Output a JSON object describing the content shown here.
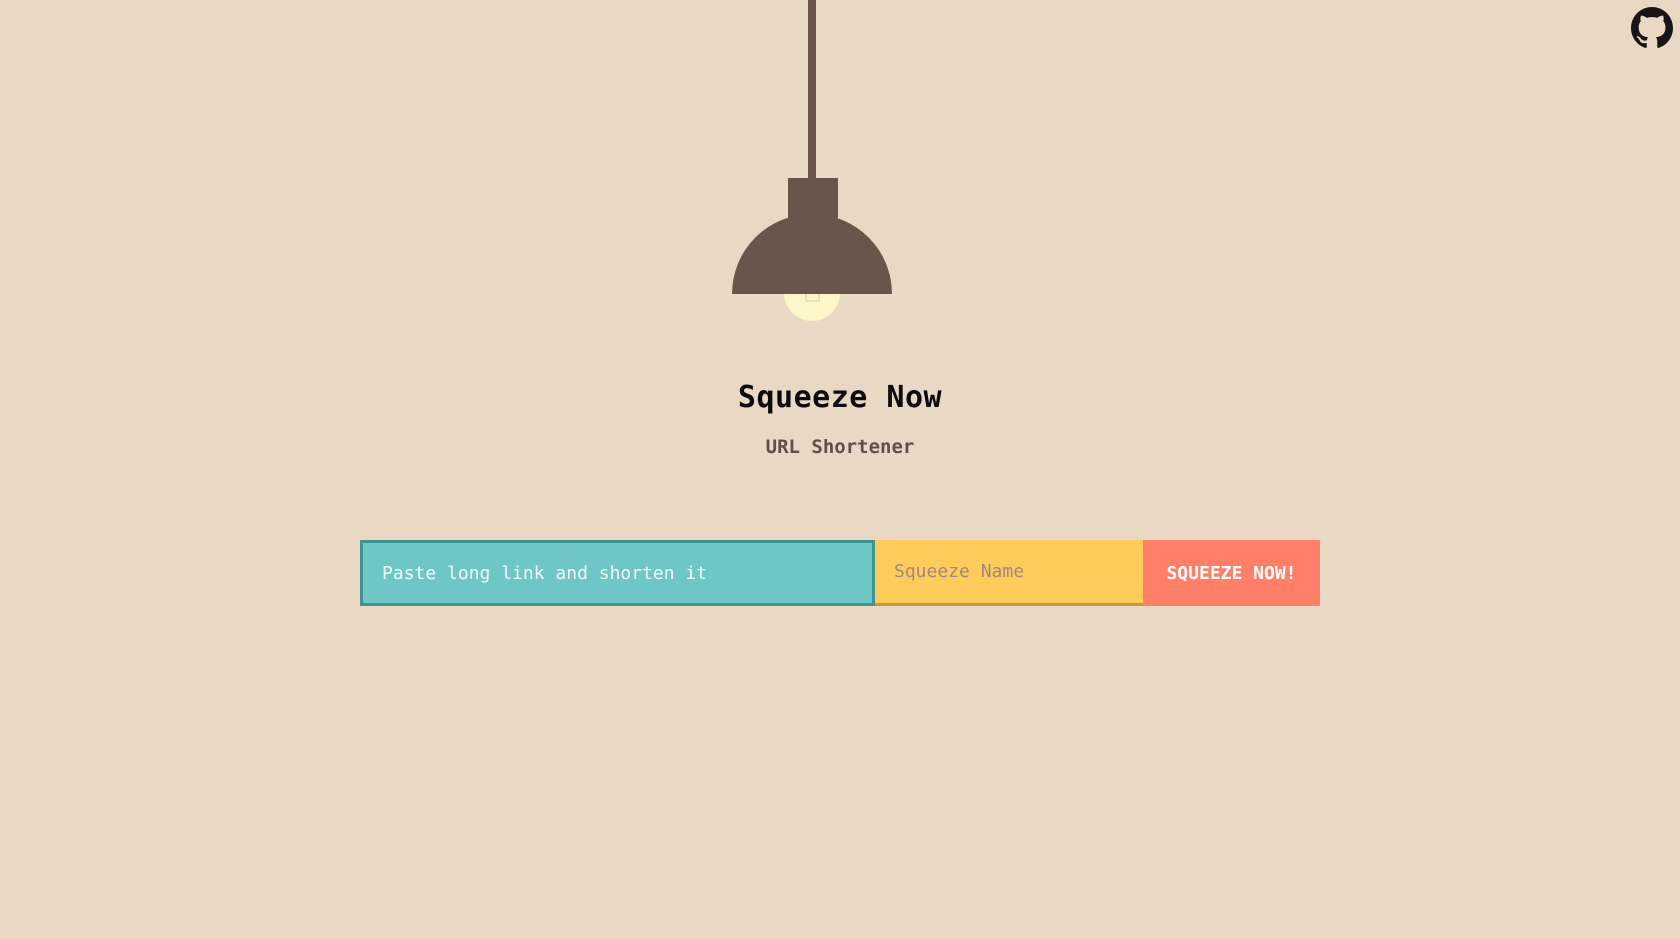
{
  "header": {
    "title": "Squeeze Now",
    "subtitle": "URL Shortener"
  },
  "form": {
    "url_placeholder": "Paste long link and shorten it",
    "name_placeholder": "Squeeze Name",
    "submit_label": "SQUEEZE NOW!"
  },
  "icons": {
    "github": "github-icon",
    "lamp": "pendant-lamp-icon"
  },
  "colors": {
    "background": "#e9d8c3",
    "lamp": "#6b544b",
    "bulb": "#fcf6c8",
    "url_field": "#6ec6c6",
    "name_field": "#ffcc5c",
    "button": "#ff7f69"
  }
}
